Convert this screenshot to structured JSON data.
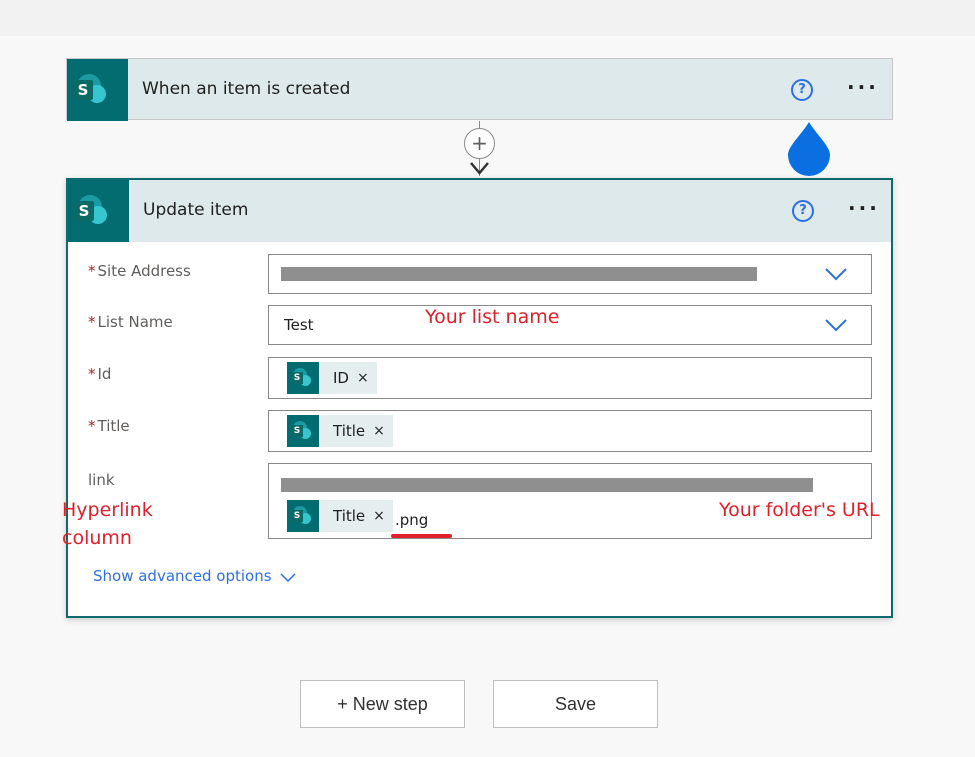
{
  "trigger": {
    "title": "When an item is created",
    "help_icon": "?",
    "more_icon": "···"
  },
  "connector": {
    "plus_icon": "+"
  },
  "action": {
    "title": "Update item",
    "help_icon": "?",
    "more_icon": "···",
    "fields": {
      "site_address": {
        "label": "Site Address",
        "required": "*"
      },
      "list_name": {
        "label": "List Name",
        "required": "*",
        "value": "Test"
      },
      "id": {
        "label": "Id",
        "required": "*",
        "token": "ID"
      },
      "title": {
        "label": "Title",
        "required": "*",
        "token": "Title"
      },
      "link": {
        "label": "link",
        "token": "Title",
        "suffix": ".png"
      }
    },
    "token_close": "×",
    "advanced_label": "Show advanced options"
  },
  "annotations": {
    "list_name": "Your list name",
    "hyperlink": "Hyperlink",
    "column": "column",
    "folder_url": "Your folder's URL"
  },
  "buttons": {
    "new_step": "+ New step",
    "save": "Save"
  },
  "colors": {
    "sharepoint_teal": "#036c70",
    "header_bg": "#dde9ea",
    "accent_blue": "#2e6fe2",
    "annotation_red": "#e0202a"
  }
}
